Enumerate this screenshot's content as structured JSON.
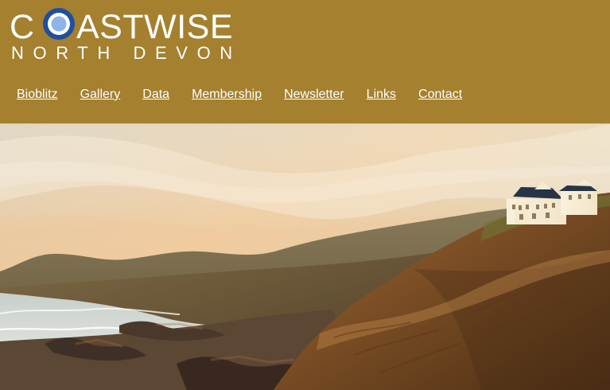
{
  "brand": {
    "name_prefix": "C",
    "name_suffix": "ASTWISE",
    "subtitle": "NORTH DEVON",
    "header_color": "#a4802f",
    "logo_ring_outer": "#1f4fa0",
    "logo_ring_inner": "#ffffff",
    "logo_center": "#8fb4e7"
  },
  "navigation": {
    "items": [
      {
        "label": "Bioblitz"
      },
      {
        "label": "Gallery"
      },
      {
        "label": "Data"
      },
      {
        "label": "Membership"
      },
      {
        "label": "Newsletter"
      },
      {
        "label": "Links"
      },
      {
        "label": "Contact"
      }
    ]
  },
  "hero": {
    "image_label": "coastal-photo"
  }
}
